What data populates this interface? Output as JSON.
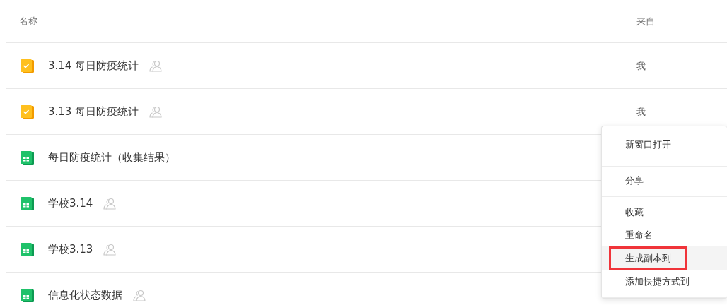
{
  "table": {
    "columns": [
      "名称",
      "来自"
    ],
    "rows": [
      {
        "kind": "form",
        "name": "3.14 每日防疫统计",
        "shared": true,
        "from": "我"
      },
      {
        "kind": "form",
        "name": "3.13 每日防疫统计",
        "shared": true,
        "from": "我"
      },
      {
        "kind": "sheet",
        "name": "每日防疫统计（收集结果）",
        "shared": false
      },
      {
        "kind": "sheet",
        "name": "学校3.14",
        "shared": true
      },
      {
        "kind": "sheet",
        "name": "学校3.13",
        "shared": true
      },
      {
        "kind": "sheet",
        "name": "信息化状态数据",
        "shared": true
      }
    ]
  },
  "context_menu": {
    "groups": [
      [
        {
          "label": "新窗口打开",
          "selected": false,
          "outlined": false
        }
      ],
      [
        {
          "label": "分享",
          "selected": false,
          "outlined": false
        }
      ],
      [
        {
          "label": "收藏",
          "selected": false,
          "outlined": false
        },
        {
          "label": "重命名",
          "selected": false,
          "outlined": false
        },
        {
          "label": "生成副本到",
          "selected": true,
          "outlined": true
        },
        {
          "label": "添加快捷方式到",
          "selected": false,
          "outlined": false
        }
      ]
    ]
  }
}
